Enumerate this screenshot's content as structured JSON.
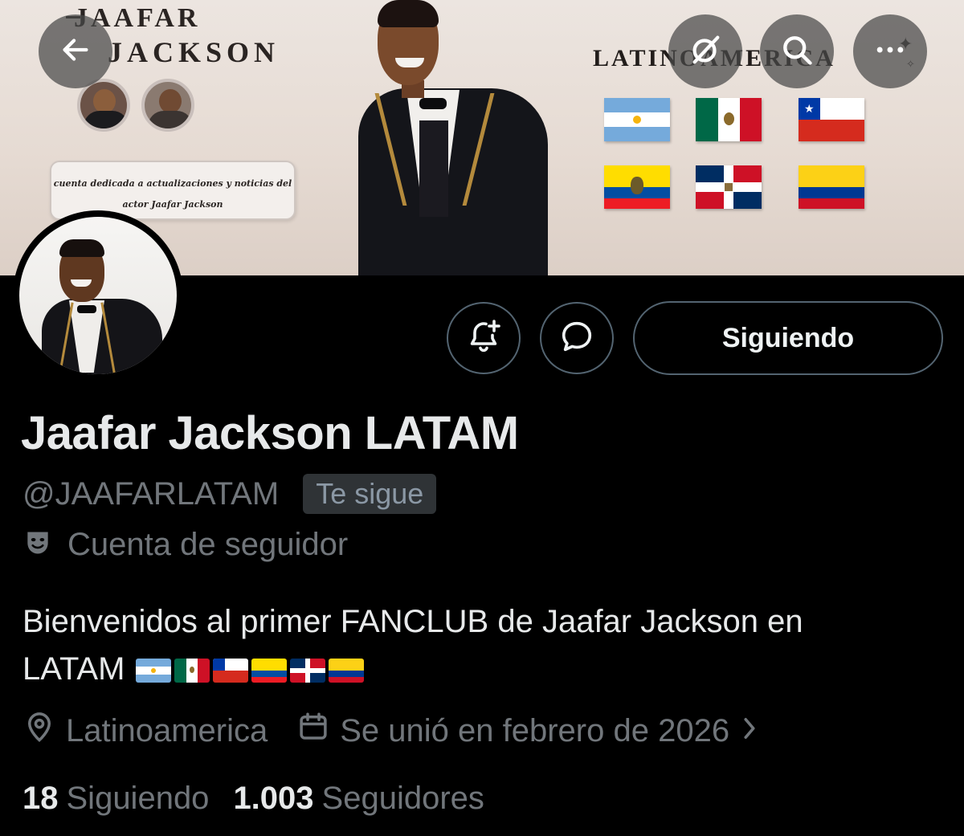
{
  "banner": {
    "title_line1": "JAAFAR",
    "title_line2": "JACKSON",
    "note_line1": "cuenta dedicada a actualizaciones y noticias del",
    "note_line2": "actor Jaafar Jackson",
    "region_word": "LATINOAMERICA",
    "flags": [
      "argentina-flag",
      "mexico-flag",
      "chile-flag",
      "ecuador-flag",
      "dominican-republic-flag",
      "colombia-flag"
    ]
  },
  "nav": {
    "back_icon": "arrow-left-icon",
    "grok_icon": "grok-icon",
    "search_icon": "search-icon",
    "more_icon": "more-icon"
  },
  "actions": {
    "notify_icon": "bell-plus-icon",
    "message_icon": "message-bubble-icon",
    "follow_label": "Siguiendo"
  },
  "profile": {
    "display_name": "Jaafar Jackson LATAM",
    "handle": "@JAAFARLATAM",
    "follows_you": "Te sigue",
    "account_type": "Cuenta de seguidor",
    "bio_line1": "Bienvenidos al primer FANCLUB de Jaafar Jackson en",
    "bio_line2": "LATAM",
    "location": "Latinoamerica",
    "joined": "Se unió en febrero de 2026",
    "following_count": "18",
    "following_label": "Siguiendo",
    "followers_count": "1.003",
    "followers_label": "Seguidores"
  },
  "colors": {
    "background": "#000000",
    "text_primary": "#e7e9ea",
    "text_secondary": "#71767b",
    "border": "#536471",
    "badge_bg": "#2f3336"
  }
}
